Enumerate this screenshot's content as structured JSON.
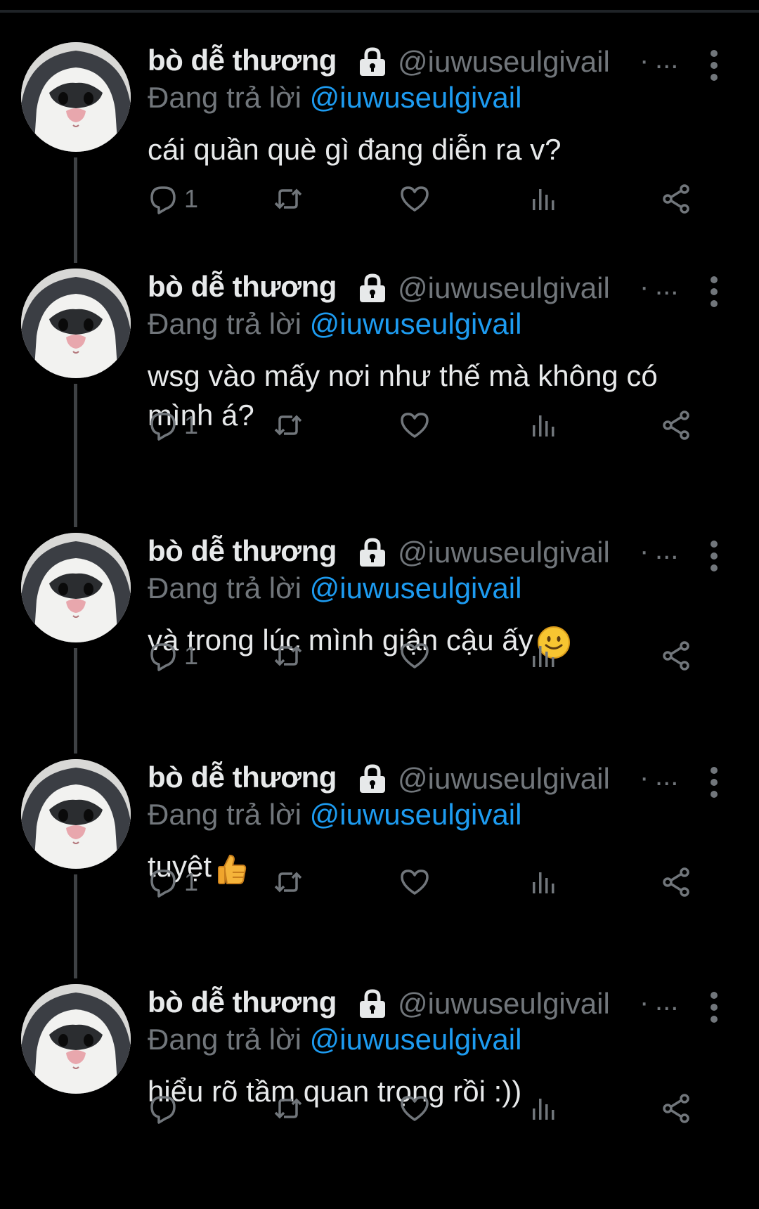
{
  "author": {
    "name": "bò dễ thương",
    "handle": "@iuwuseulgivail",
    "dot": "·",
    "time": "..."
  },
  "reply_prefix": "Đang trả lời",
  "reply_to": "@iuwuseulgivail",
  "icons": {
    "lock": "lock-icon",
    "menu": "more-vertical-icon",
    "reply": "reply-icon",
    "retweet": "retweet-icon",
    "like": "heart-icon",
    "views": "views-icon",
    "share": "share-icon"
  },
  "tweets": [
    {
      "text": "cái quần què gì đang diễn ra v?",
      "emoji": "",
      "reply_count": "1"
    },
    {
      "text": "wsg vào mấy nơi như thế mà không có mình á?",
      "emoji": "",
      "reply_count": "1"
    },
    {
      "text": "và trong lúc mình giận cậu ấy",
      "emoji": "slightly-smiling-face",
      "reply_count": "1"
    },
    {
      "text": "tuyệt",
      "emoji": "thumbs-up",
      "reply_count": "1"
    },
    {
      "text": "hiểu rõ tầm quan trọng rồi :))",
      "emoji": "",
      "reply_count": ""
    }
  ],
  "colors": {
    "background": "#000000",
    "text": "#e7e9ea",
    "secondary": "#71767b",
    "mention": "#1d9bf0",
    "thread_line": "#3e4144"
  }
}
